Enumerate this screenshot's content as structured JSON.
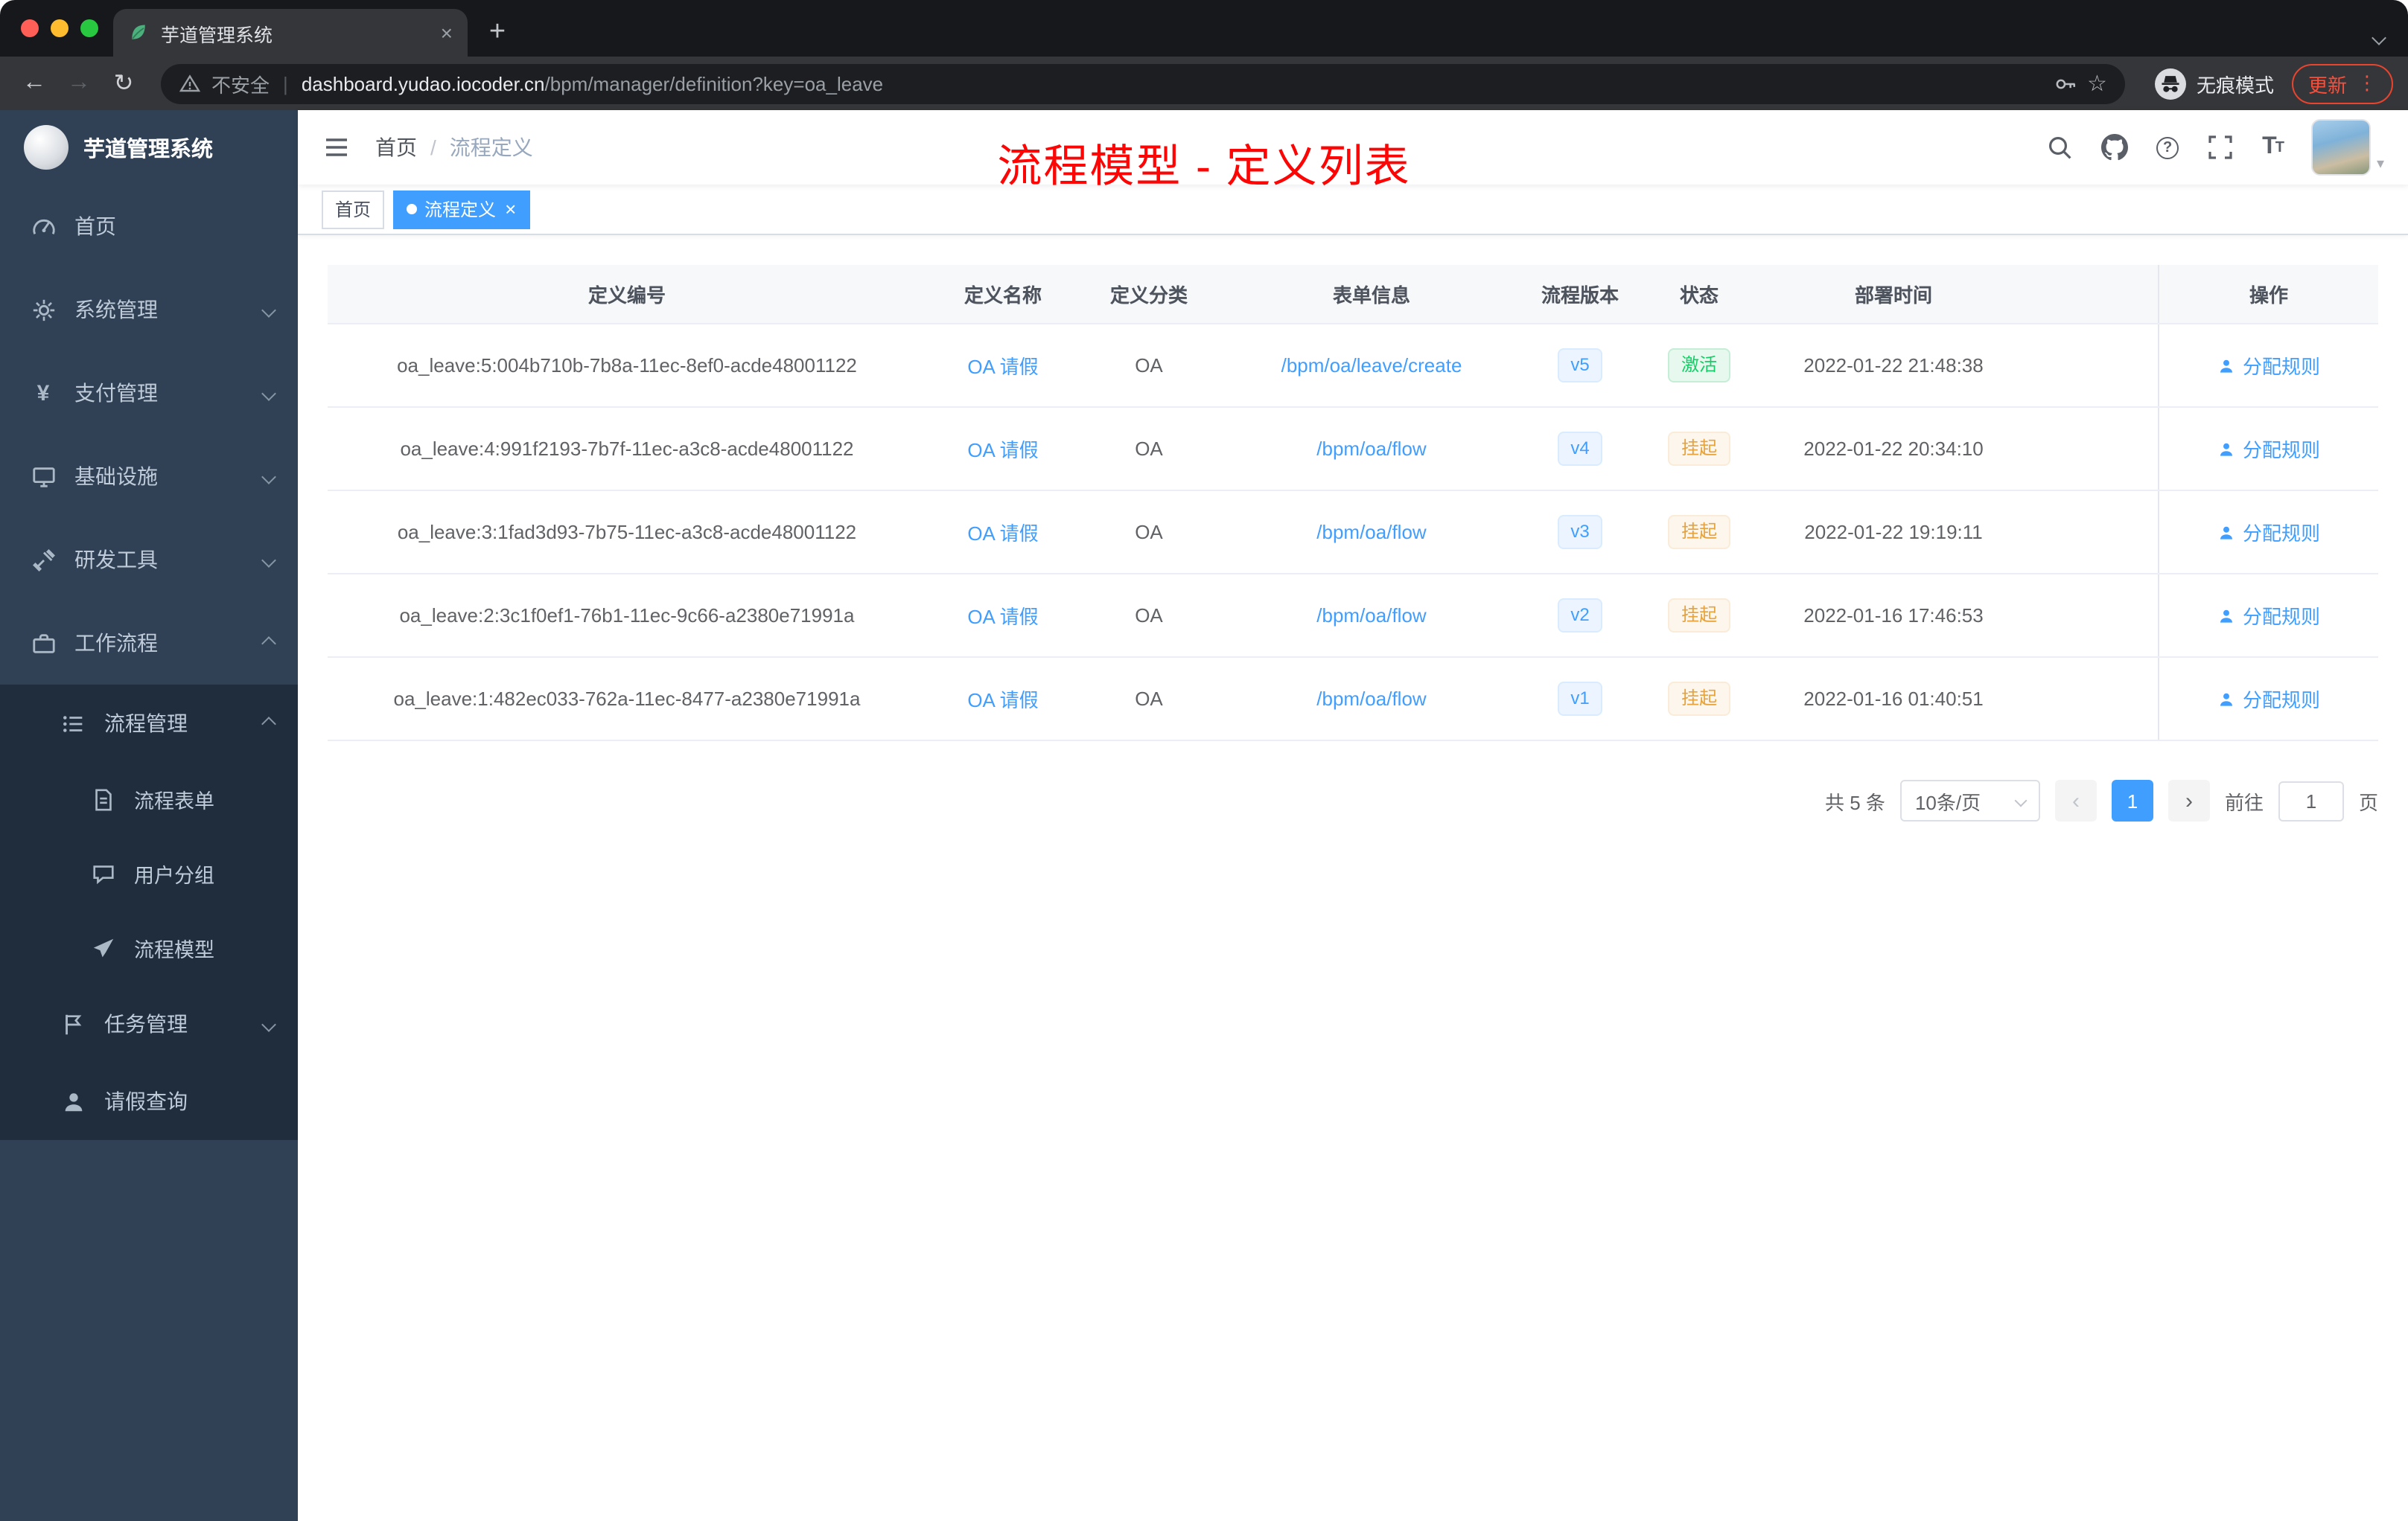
{
  "colors": {
    "accent": "#409eff",
    "success": "#13ce66",
    "warning": "#e6a23c",
    "title_red": "#fb0505",
    "sidebar_bg": "#304156",
    "submenu_bg": "#1f2d3d"
  },
  "browser": {
    "tab_title": "芋道管理系统",
    "security_label": "不安全",
    "url_domain": "dashboard.yudao.iocoder.cn",
    "url_path": "/bpm/manager/definition?key=oa_leave",
    "incognito_label": "无痕模式",
    "update_label": "更新"
  },
  "sidebar": {
    "logo_title": "芋道管理系统",
    "items": [
      {
        "key": "home",
        "label": "首页",
        "icon": "gauge",
        "level": 1
      },
      {
        "key": "system",
        "label": "系统管理",
        "icon": "gear",
        "level": 1,
        "chevron": "down"
      },
      {
        "key": "payment",
        "label": "支付管理",
        "icon": "yen",
        "level": 1,
        "chevron": "down"
      },
      {
        "key": "infrastructure",
        "label": "基础设施",
        "icon": "monitor",
        "level": 1,
        "chevron": "down"
      },
      {
        "key": "devtools",
        "label": "研发工具",
        "icon": "tools",
        "level": 1,
        "chevron": "down"
      },
      {
        "key": "workflow",
        "label": "工作流程",
        "icon": "briefcase",
        "level": 1,
        "chevron": "up"
      },
      {
        "key": "process-management",
        "label": "流程管理",
        "icon": "list",
        "level": 2,
        "chevron": "up",
        "submenu": true
      },
      {
        "key": "process-form",
        "label": "流程表单",
        "icon": "form",
        "level": 3,
        "submenu": true
      },
      {
        "key": "user-group",
        "label": "用户分组",
        "icon": "chat",
        "level": 3,
        "submenu": true
      },
      {
        "key": "process-model",
        "label": "流程模型",
        "icon": "send",
        "level": 3,
        "submenu": true
      },
      {
        "key": "task-management",
        "label": "任务管理",
        "icon": "flag",
        "level": 2,
        "chevron": "down",
        "submenu": true
      },
      {
        "key": "leave-query",
        "label": "请假查询",
        "icon": "user",
        "level": 2,
        "submenu": true
      }
    ]
  },
  "header": {
    "breadcrumb": [
      "首页",
      "流程定义"
    ],
    "overlay_title": "流程模型 - 定义列表",
    "icons": [
      "search",
      "github",
      "question",
      "fullscreen",
      "fontsize"
    ]
  },
  "tags": [
    {
      "label": "首页",
      "active": false,
      "closable": false
    },
    {
      "label": "流程定义",
      "active": true,
      "closable": true
    }
  ],
  "table": {
    "columns": [
      "定义编号",
      "定义名称",
      "定义分类",
      "表单信息",
      "流程版本",
      "状态",
      "部署时间",
      "操作"
    ],
    "rows": [
      {
        "id": "oa_leave:5:004b710b-7b8a-11ec-8ef0-acde48001122",
        "name": "OA 请假",
        "category": "OA",
        "form": "/bpm/oa/leave/create",
        "version": "v5",
        "status": "激活",
        "status_type": "success",
        "deployed": "2022-01-22 21:48:38",
        "action": "分配规则"
      },
      {
        "id": "oa_leave:4:991f2193-7b7f-11ec-a3c8-acde48001122",
        "name": "OA 请假",
        "category": "OA",
        "form": "/bpm/oa/flow",
        "version": "v4",
        "status": "挂起",
        "status_type": "warning",
        "deployed": "2022-01-22 20:34:10",
        "action": "分配规则"
      },
      {
        "id": "oa_leave:3:1fad3d93-7b75-11ec-a3c8-acde48001122",
        "name": "OA 请假",
        "category": "OA",
        "form": "/bpm/oa/flow",
        "version": "v3",
        "status": "挂起",
        "status_type": "warning",
        "deployed": "2022-01-22 19:19:11",
        "action": "分配规则"
      },
      {
        "id": "oa_leave:2:3c1f0ef1-76b1-11ec-9c66-a2380e71991a",
        "name": "OA 请假",
        "category": "OA",
        "form": "/bpm/oa/flow",
        "version": "v2",
        "status": "挂起",
        "status_type": "warning",
        "deployed": "2022-01-16 17:46:53",
        "action": "分配规则"
      },
      {
        "id": "oa_leave:1:482ec033-762a-11ec-8477-a2380e71991a",
        "name": "OA 请假",
        "category": "OA",
        "form": "/bpm/oa/flow",
        "version": "v1",
        "status": "挂起",
        "status_type": "warning",
        "deployed": "2022-01-16 01:40:51",
        "action": "分配规则"
      }
    ]
  },
  "pagination": {
    "total": "共 5 条",
    "page_size": "10条/页",
    "current_page": "1",
    "goto_label": "前往",
    "goto_value": "1",
    "page_label": "页"
  }
}
